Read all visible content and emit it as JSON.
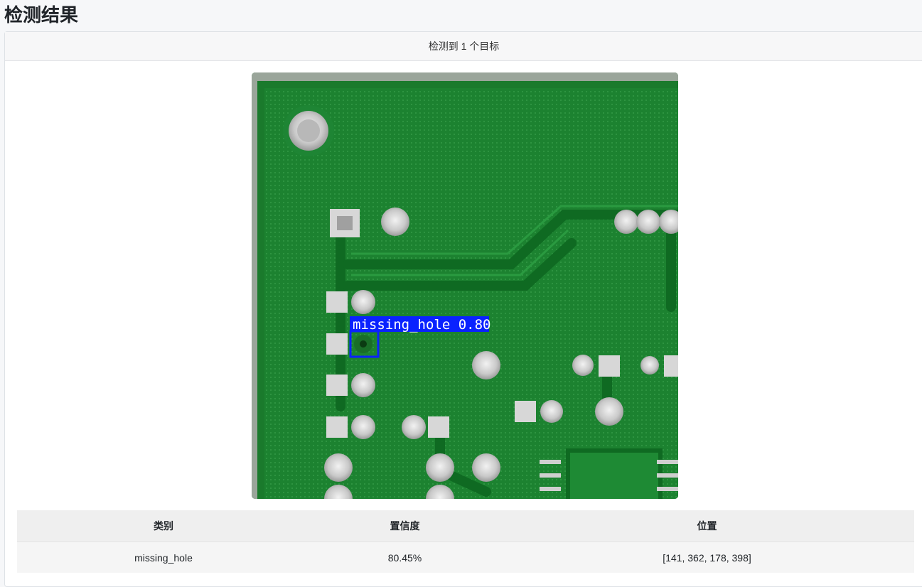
{
  "page": {
    "title": "检测结果"
  },
  "summary": {
    "text": "检测到 1 个目标"
  },
  "detection_image": {
    "box_label": "missing_hole 0.80",
    "box_color": "#0a22ff",
    "board_color": "#1b7e2f"
  },
  "results_table": {
    "headers": [
      "类别",
      "置信度",
      "位置"
    ],
    "rows": [
      [
        "missing_hole",
        "80.45%",
        "[141, 362, 178, 398]"
      ]
    ]
  }
}
